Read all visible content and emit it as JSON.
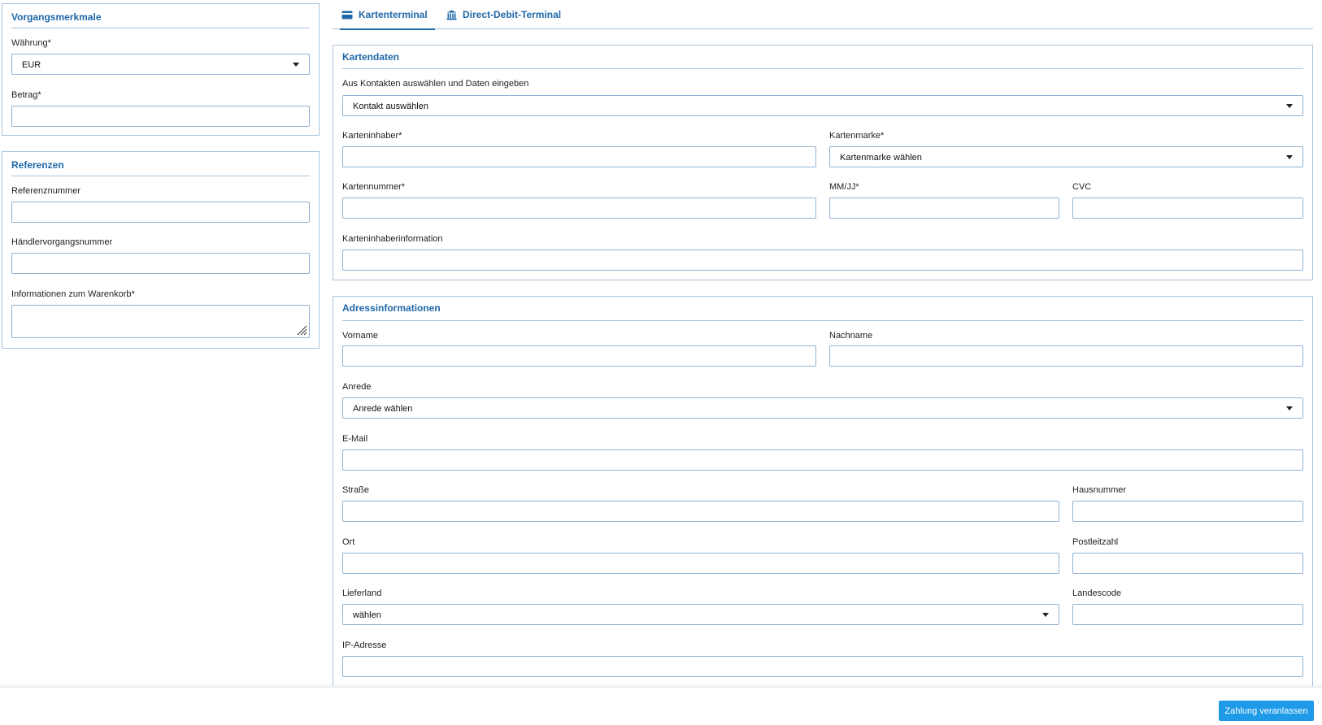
{
  "tabs": [
    {
      "label": "Kartenterminal",
      "icon": "credit-card-icon"
    },
    {
      "label": "Direct-Debit-Terminal",
      "icon": "bank-icon"
    }
  ],
  "vorgang": {
    "title": "Vorgangsmerkmale",
    "currency_label": "Währung*",
    "currency_value": "EUR",
    "amount_label": "Betrag*",
    "amount_value": ""
  },
  "referenzen": {
    "title": "Referenzen",
    "refnum_label": "Referenznummer",
    "merchant_label": "Händlervorgangsnummer",
    "cart_label": "Informationen zum Warenkorb*"
  },
  "kartendaten": {
    "title": "Kartendaten",
    "contact_label": "Aus Kontakten auswählen und Daten eingeben",
    "contact_value": "Kontakt auswählen",
    "holder_label": "Karteninhaber*",
    "brand_label": "Kartenmarke*",
    "brand_value": "Kartenmarke wählen",
    "number_label": "Kartennummer*",
    "expiry_label": "MM/JJ*",
    "cvc_label": "CVC",
    "holderinfo_label": "Karteninhaberinformation"
  },
  "adresse": {
    "title": "Adressinformationen",
    "firstname_label": "Vorname",
    "lastname_label": "Nachname",
    "salutation_label": "Anrede",
    "salutation_value": "Anrede wählen",
    "email_label": "E-Mail",
    "street_label": "Straße",
    "housenum_label": "Hausnummer",
    "city_label": "Ort",
    "zip_label": "Postleitzahl",
    "country_label": "Lieferland",
    "country_value": "wählen",
    "countrycode_label": "Landescode",
    "ip_label": "IP-Adresse"
  },
  "footer": {
    "submit_label": "Zahlung veranlassen"
  },
  "colors": {
    "accent": "#1f68a8",
    "border": "#8fb3d3",
    "button": "#1e9ae8"
  }
}
